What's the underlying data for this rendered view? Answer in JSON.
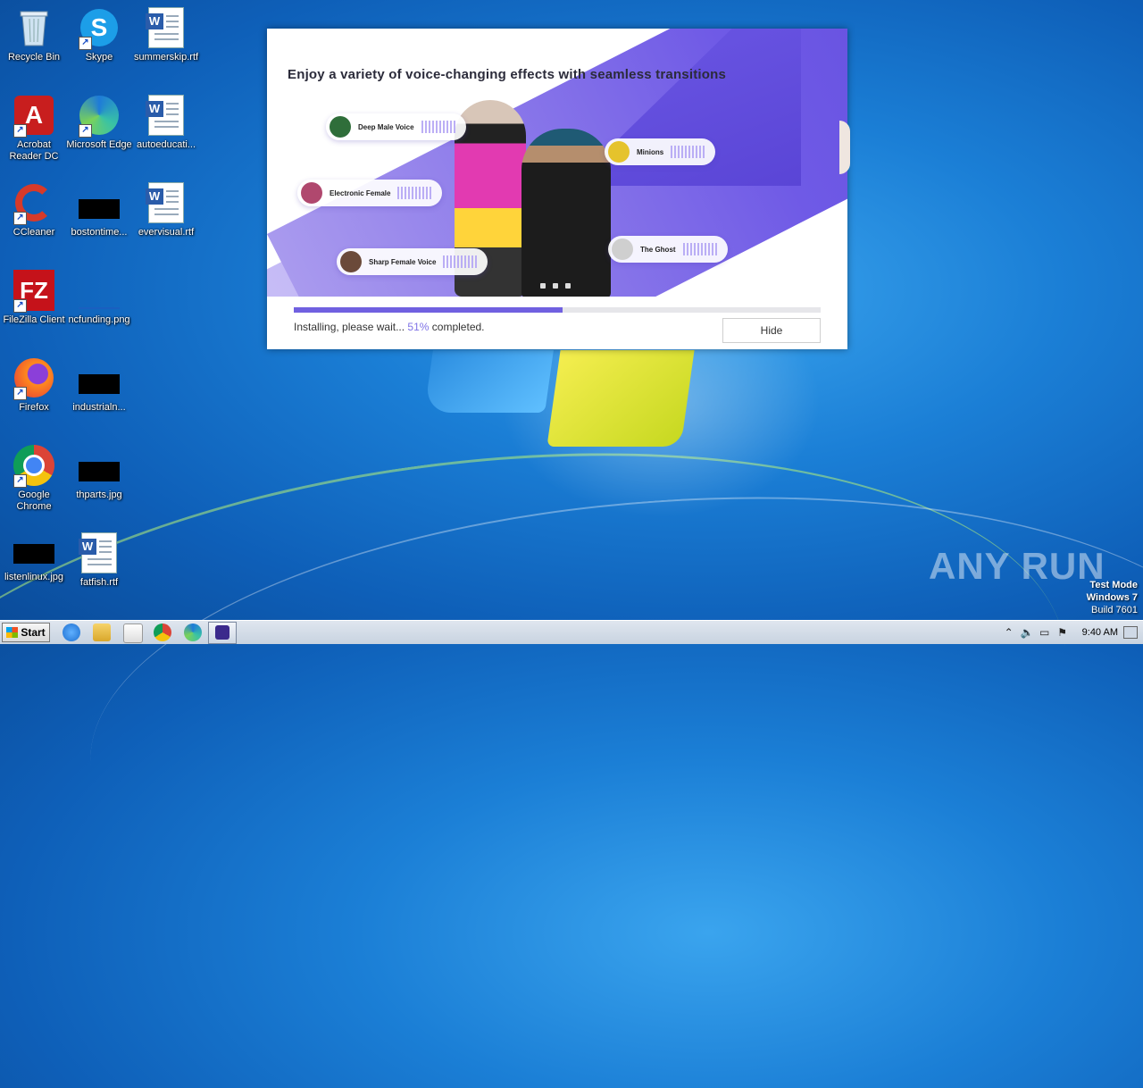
{
  "desktop": {
    "icons": [
      {
        "label": "Recycle Bin"
      },
      {
        "label": "Skype"
      },
      {
        "label": "summerskip.rtf"
      },
      {
        "label": "Acrobat Reader DC"
      },
      {
        "label": "Microsoft Edge"
      },
      {
        "label": "autoeducati..."
      },
      {
        "label": "CCleaner"
      },
      {
        "label": "bostontime..."
      },
      {
        "label": "evervisual.rtf"
      },
      {
        "label": "FileZilla Client"
      },
      {
        "label": "ncfunding.png"
      },
      {
        "label": "Firefox"
      },
      {
        "label": "industrialn..."
      },
      {
        "label": "Google Chrome"
      },
      {
        "label": "thparts.jpg"
      },
      {
        "label": "listenlinux.jpg"
      },
      {
        "label": "fatfish.rtf"
      }
    ]
  },
  "installer": {
    "banner_title": "Enjoy a variety of voice-changing effects with seamless transitions",
    "voices": [
      {
        "name": "Deep Male Voice",
        "color": "#2f6e3a"
      },
      {
        "name": "Electronic Female",
        "color": "#b0486e"
      },
      {
        "name": "Sharp Female Voice",
        "color": "#6b4a3a"
      },
      {
        "name": "Minions",
        "color": "#e5c32c"
      },
      {
        "name": "The Ghost",
        "color": "#cfcfcf"
      }
    ],
    "progress_percent": 51,
    "status_prefix": "Installing, please wait...",
    "status_pct": "51%",
    "status_suffix": "completed.",
    "hide_label": "Hide",
    "accent_color": "#7060e0"
  },
  "watermark": "ANY RUN",
  "system": {
    "test_mode": "Test Mode",
    "os": "Windows 7",
    "build": "Build 7601"
  },
  "taskbar": {
    "start_label": "Start",
    "clock": "9:40 AM"
  }
}
